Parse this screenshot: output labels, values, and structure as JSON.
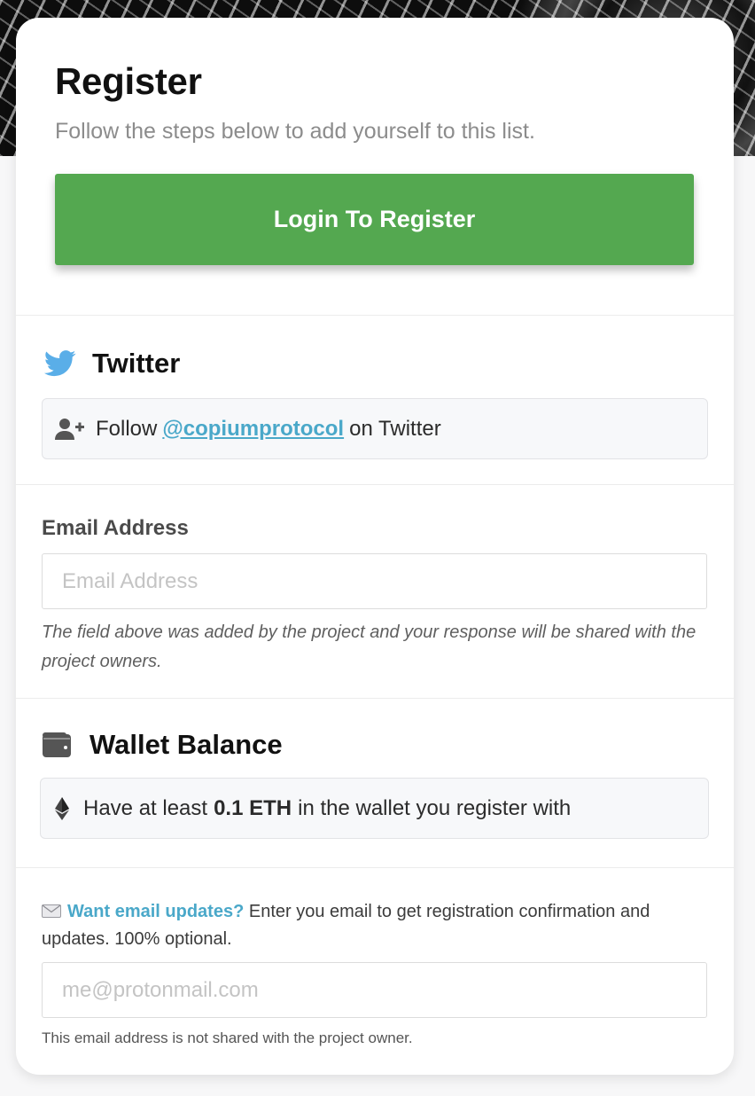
{
  "header": {
    "title": "Register",
    "subtitle": "Follow the steps below to add yourself to this list.",
    "login_button": "Login To Register"
  },
  "twitter": {
    "title": "Twitter",
    "icon": "twitter-bird-icon",
    "task_prefix": "Follow",
    "handle": "@copiumprotocol",
    "task_suffix": "on Twitter",
    "task_icon": "user-plus-icon"
  },
  "email_field": {
    "label": "Email Address",
    "placeholder": "Email Address",
    "value": "",
    "help": "The field above was added by the project and your response will be shared with the project owners."
  },
  "wallet": {
    "title": "Wallet Balance",
    "icon": "wallet-icon",
    "task_icon": "ethereum-icon",
    "task_prefix": "Have at least",
    "amount": "0.1 ETH",
    "task_suffix": "in the wallet you register with"
  },
  "updates": {
    "icon": "envelope-icon",
    "link": "Want email updates?",
    "text": "Enter you email to get registration confirmation and updates. 100% optional.",
    "placeholder": "me@protonmail.com",
    "value": "",
    "help": "This email address is not shared with the project owner."
  },
  "colors": {
    "button_green": "#54a850",
    "link_blue": "#4aa8c9",
    "twitter_blue": "#5aaee8"
  }
}
